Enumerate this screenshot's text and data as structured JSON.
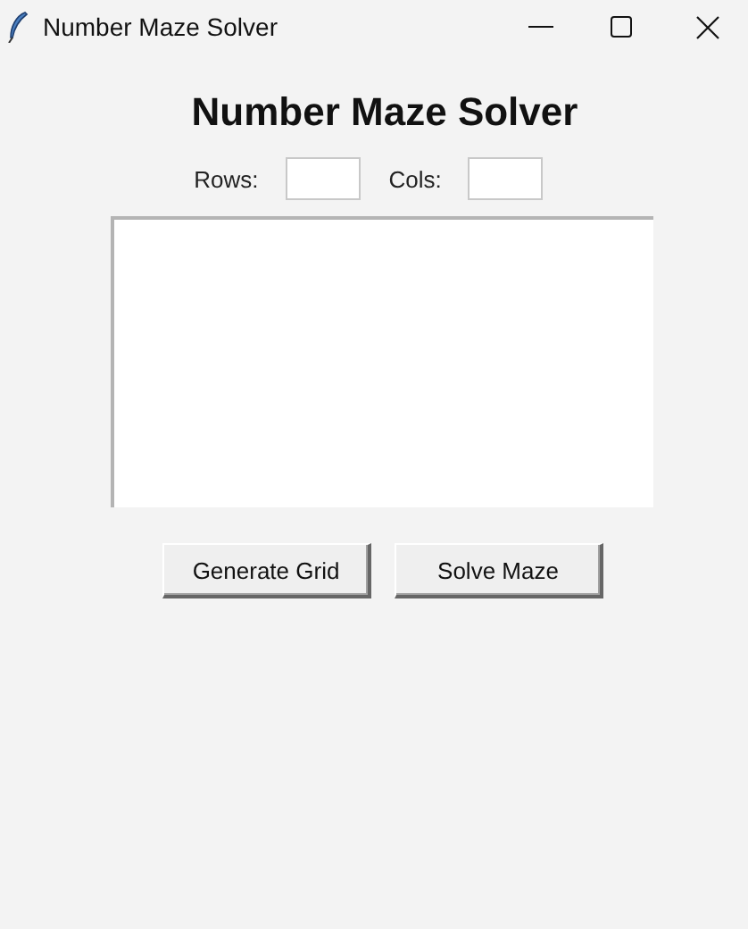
{
  "window": {
    "title": "Number Maze Solver"
  },
  "heading": "Number Maze Solver",
  "fields": [
    {
      "label": "Rows:"
    },
    {
      "label": "Cols:"
    }
  ],
  "buttons": [
    "Generate Grid",
    "Solve Maze"
  ]
}
